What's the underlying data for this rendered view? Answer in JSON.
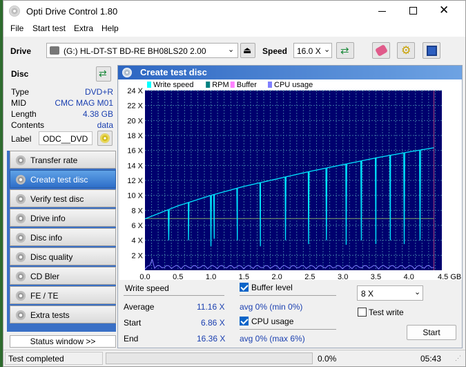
{
  "app": {
    "title": "Opti Drive Control 1.80"
  },
  "menu": [
    "File",
    "Start test",
    "Extra",
    "Help"
  ],
  "toolbar": {
    "drive_label": "Drive",
    "drive_value": "(G:)  HL-DT-ST BD-RE  BH08LS20 2.00",
    "speed_label": "Speed",
    "speed_value": "16.0 X"
  },
  "disc": {
    "header": "Disc",
    "rows": [
      {
        "key": "Type",
        "value": "DVD+R"
      },
      {
        "key": "MID",
        "value": "CMC MAG M01"
      },
      {
        "key": "Length",
        "value": "4.38 GB"
      },
      {
        "key": "Contents",
        "value": "data"
      }
    ],
    "label_key": "Label",
    "label_value": "ODC__DVD"
  },
  "nav": [
    {
      "label": "Transfer rate",
      "active": false
    },
    {
      "label": "Create test disc",
      "active": true
    },
    {
      "label": "Verify test disc",
      "active": false
    },
    {
      "label": "Drive info",
      "active": false
    },
    {
      "label": "Disc info",
      "active": false
    },
    {
      "label": "Disc quality",
      "active": false
    },
    {
      "label": "CD Bler",
      "active": false
    },
    {
      "label": "FE / TE",
      "active": false
    },
    {
      "label": "Extra tests",
      "active": false
    }
  ],
  "status_window_label": "Status window >>",
  "panel": {
    "title": "Create test disc"
  },
  "chart_data": {
    "type": "line",
    "legend": [
      "Write speed",
      "RPM",
      "Buffer",
      "CPU usage"
    ],
    "legend_colors": [
      "#00ffff",
      "#008080",
      "#ff80ff",
      "#8080ff"
    ],
    "xlabel": "GB",
    "x_ticks": [
      "0.0",
      "0.5",
      "1.0",
      "1.5",
      "2.0",
      "2.5",
      "3.0",
      "3.5",
      "4.0",
      "4.5 GB"
    ],
    "y_ticks": [
      "2 X",
      "4 X",
      "6 X",
      "8 X",
      "10 X",
      "12 X",
      "14 X",
      "16 X",
      "18 X",
      "20 X",
      "22 X",
      "24 X"
    ],
    "xlim": [
      0,
      4.5
    ],
    "ylim": [
      0,
      24
    ],
    "series": [
      {
        "name": "Write speed",
        "x": [
          0,
          0.5,
          1.0,
          1.5,
          2.0,
          2.5,
          3.0,
          3.5,
          4.0,
          4.38
        ],
        "values": [
          6.86,
          8.6,
          10.0,
          11.2,
          12.2,
          13.2,
          14.1,
          15.0,
          15.8,
          16.36
        ]
      },
      {
        "name": "RPM",
        "x": [
          0,
          4.38
        ],
        "values": [
          6.9,
          6.9
        ]
      }
    ],
    "dips_x": [
      0.36,
      0.66,
      1.0,
      1.05,
      1.4,
      1.75,
      2.13,
      2.48,
      2.75,
      3.05,
      3.28,
      3.5,
      3.72,
      3.93,
      4.17
    ],
    "dips_to": [
      4.0,
      4.0,
      3.2,
      4.2,
      4.0,
      3.2,
      4.0,
      3.5,
      4.0,
      3.4,
      4.0,
      3.5,
      4.0,
      3.5,
      4.0
    ],
    "end_marker_x": 4.38
  },
  "results": {
    "write_speed_header": "Write speed",
    "average_label": "Average",
    "average_value": "11.16 X",
    "start_label": "Start",
    "start_value": "6.86 X",
    "end_label": "End",
    "end_value": "16.36 X",
    "buffer_label": "Buffer level",
    "buffer_stat": "avg 0% (min 0%)",
    "cpu_label": "CPU usage",
    "cpu_stat": "avg 0% (max 6%)",
    "speed_select": "8 X",
    "test_write_label": "Test write",
    "start_button": "Start"
  },
  "status": {
    "text": "Test completed",
    "progress": "0.0%",
    "time": "05:43"
  }
}
